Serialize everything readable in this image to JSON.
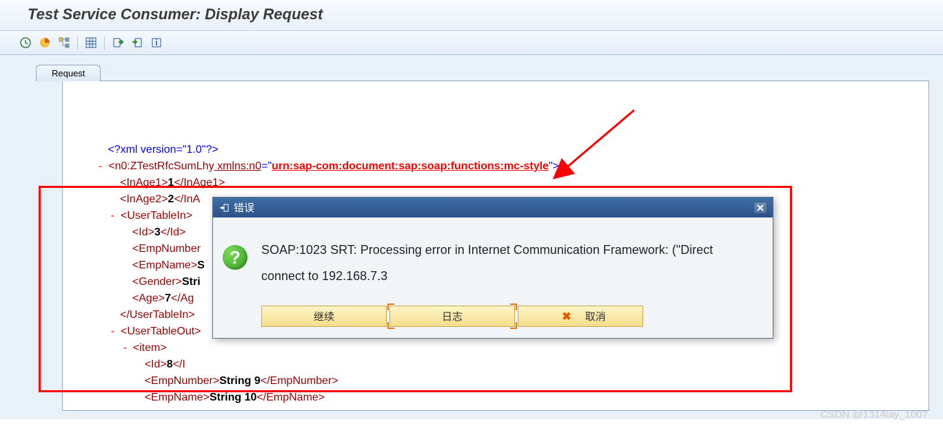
{
  "header": {
    "title": "Test Service Consumer: Display Request"
  },
  "tab": {
    "label": "Request"
  },
  "xml": {
    "pi": "<?xml version=\"1.0\"?>",
    "root_open": "<n0:ZTestRfcSumLhy",
    "root_ns_attr": " xmlns:n0",
    "root_ns_val": "urn:sap-com:document:sap:soap:functions:mc-style",
    "inage1_open": "<InAge1>",
    "inage1_val": "1",
    "inage1_close": "</InAge1>",
    "inage2_open": "<InAge2>",
    "inage2_val": "2",
    "inage2_close_partial": "</InA",
    "usertablein_open": "<UserTableIn>",
    "id_open": "<Id>",
    "id_val": "3",
    "id_close": "</Id>",
    "empnumber_open_partial": "<EmpNumber",
    "empname_open": "<EmpName>",
    "empname_val_partial": "S",
    "gender_open": "<Gender>",
    "gender_val_partial": "Stri",
    "age_open": "<Age>",
    "age_val": "7",
    "age_close_partial": "</Ag",
    "usertablein_close": "</UserTableIn>",
    "usertableout_open": "<UserTableOut>",
    "item_open": "<item>",
    "id2_open": "<Id>",
    "id2_val": "8",
    "id2_close_partial": "</I",
    "empnumber2_open": "<EmpNumber>",
    "empnumber2_val": "String 9",
    "empnumber2_close": "</EmpNumber>",
    "empname2_open": "<EmpName>",
    "empname2_val": "String 10",
    "empname2_close": "</EmpName>"
  },
  "dialog": {
    "title": "错误",
    "message": "SOAP:1023 SRT: Processing error in Internet Communication Framework: (\"Direct connect to 192.168.7.3",
    "btn_continue": "继续",
    "btn_log": "日志",
    "btn_cancel": "取消"
  },
  "watermark": "CSDN @1314lay_1007"
}
